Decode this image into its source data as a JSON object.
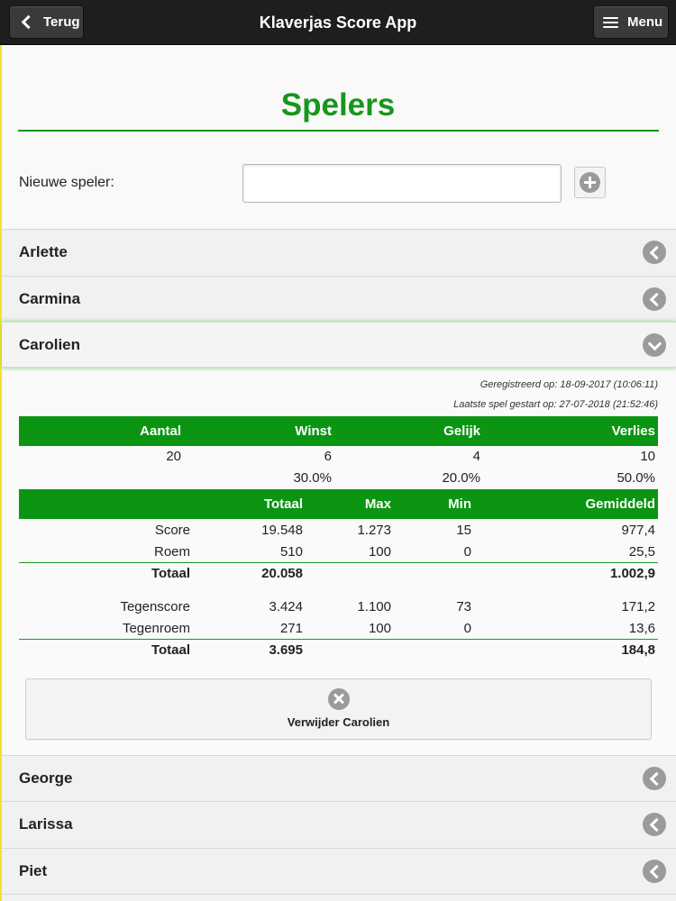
{
  "header": {
    "back_label": "Terug",
    "title": "Klaverjas Score App",
    "menu_label": "Menu"
  },
  "page": {
    "title": "Spelers",
    "new_player_label": "Nieuwe speler:",
    "new_player_value": "",
    "new_player_placeholder": ""
  },
  "players_before": [
    "Arlette",
    "Carmina"
  ],
  "expanded_player": {
    "name": "Carolien",
    "registered": "Geregistreerd op: 18-09-2017 (10:06:11)",
    "last_game": "Laatste spel gestart op: 27-07-2018 (21:52:46)",
    "summary_headers": [
      "Aantal",
      "Winst",
      "Gelijk",
      "Verlies"
    ],
    "summary_counts": [
      "20",
      "6",
      "4",
      "10"
    ],
    "summary_percents": [
      "",
      "30.0%",
      "20.0%",
      "50.0%"
    ],
    "stats_headers": [
      "",
      "Totaal",
      "Max",
      "Min",
      "Gemiddeld"
    ],
    "stats_rows": [
      [
        "Score",
        "19.548",
        "1.273",
        "15",
        "977,4"
      ],
      [
        "Roem",
        "510",
        "100",
        "0",
        "25,5"
      ],
      [
        "Totaal",
        "20.058",
        "",
        "",
        "1.002,9"
      ],
      [
        "Tegenscore",
        "3.424",
        "1.100",
        "73",
        "171,2"
      ],
      [
        "Tegenroem",
        "271",
        "100",
        "0",
        "13,6"
      ],
      [
        "Totaal",
        "3.695",
        "",
        "",
        "184,8"
      ]
    ],
    "remove_label": "Verwijder Carolien"
  },
  "players_after": [
    "George",
    "Larissa",
    "Piet"
  ],
  "icons": {
    "back": "chevron-left-icon",
    "menu": "hamburger-icon",
    "add": "plus-circle-icon",
    "collapsed": "chevron-left-circle-icon",
    "expanded": "chevron-down-circle-icon",
    "remove": "x-circle-icon"
  },
  "colors": {
    "accent": "#17961c",
    "table_header": "#0b9512",
    "header_bg": "#1e1e1e",
    "icon_gray": "#9b9b9b"
  }
}
